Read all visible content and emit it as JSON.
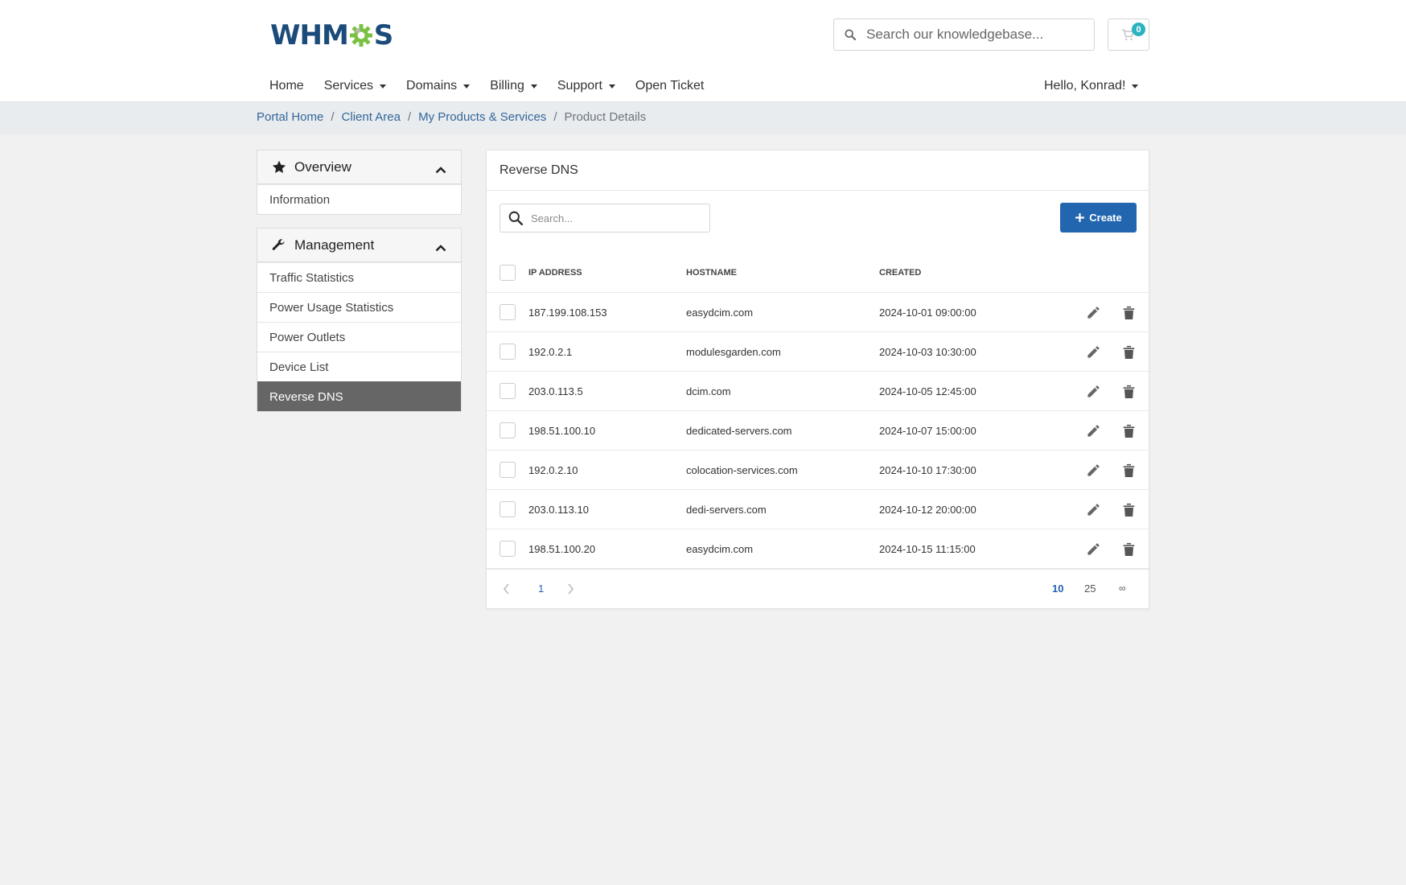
{
  "header": {
    "logo_text_left": "WHM",
    "logo_text_right": "S",
    "search_placeholder": "Search our knowledgebase...",
    "cart_count": "0"
  },
  "nav": {
    "items": [
      {
        "label": "Home",
        "dropdown": false
      },
      {
        "label": "Services",
        "dropdown": true
      },
      {
        "label": "Domains",
        "dropdown": true
      },
      {
        "label": "Billing",
        "dropdown": true
      },
      {
        "label": "Support",
        "dropdown": true
      },
      {
        "label": "Open Ticket",
        "dropdown": false
      }
    ],
    "user_label": "Hello, Konrad!"
  },
  "breadcrumb": {
    "links": [
      "Portal Home",
      "Client Area",
      "My Products & Services"
    ],
    "current": "Product Details"
  },
  "sidebar": {
    "overview": {
      "title": "Overview",
      "items": [
        "Information"
      ]
    },
    "management": {
      "title": "Management",
      "items": [
        "Traffic Statistics",
        "Power Usage Statistics",
        "Power Outlets",
        "Device List",
        "Reverse DNS"
      ],
      "active": "Reverse DNS"
    }
  },
  "main": {
    "title": "Reverse DNS",
    "search_placeholder": "Search...",
    "create_label": "Create",
    "columns": [
      "IP ADDRESS",
      "HOSTNAME",
      "CREATED"
    ],
    "rows": [
      {
        "ip": "187.199.108.153",
        "hostname": "easydcim.com",
        "created": "2024-10-01 09:00:00"
      },
      {
        "ip": "192.0.2.1",
        "hostname": "modulesgarden.com",
        "created": "2024-10-03 10:30:00"
      },
      {
        "ip": "203.0.113.5",
        "hostname": "dcim.com",
        "created": "2024-10-05 12:45:00"
      },
      {
        "ip": "198.51.100.10",
        "hostname": "dedicated-servers.com",
        "created": "2024-10-07 15:00:00"
      },
      {
        "ip": "192.0.2.10",
        "hostname": "colocation-services.com",
        "created": "2024-10-10 17:30:00"
      },
      {
        "ip": "203.0.113.10",
        "hostname": "dedi-servers.com",
        "created": "2024-10-12 20:00:00"
      },
      {
        "ip": "198.51.100.20",
        "hostname": "easydcim.com",
        "created": "2024-10-15 11:15:00"
      }
    ],
    "pagination": {
      "current_page": "1",
      "per_page_options": [
        "10",
        "25",
        "∞"
      ],
      "per_page_selected": "10"
    }
  },
  "colors": {
    "accent": "#2266b0",
    "link": "#336699",
    "badge": "#2bb3c0",
    "active_sidebar": "#666666",
    "logo_blue": "#1b4b7a",
    "logo_green": "#7ac142"
  }
}
